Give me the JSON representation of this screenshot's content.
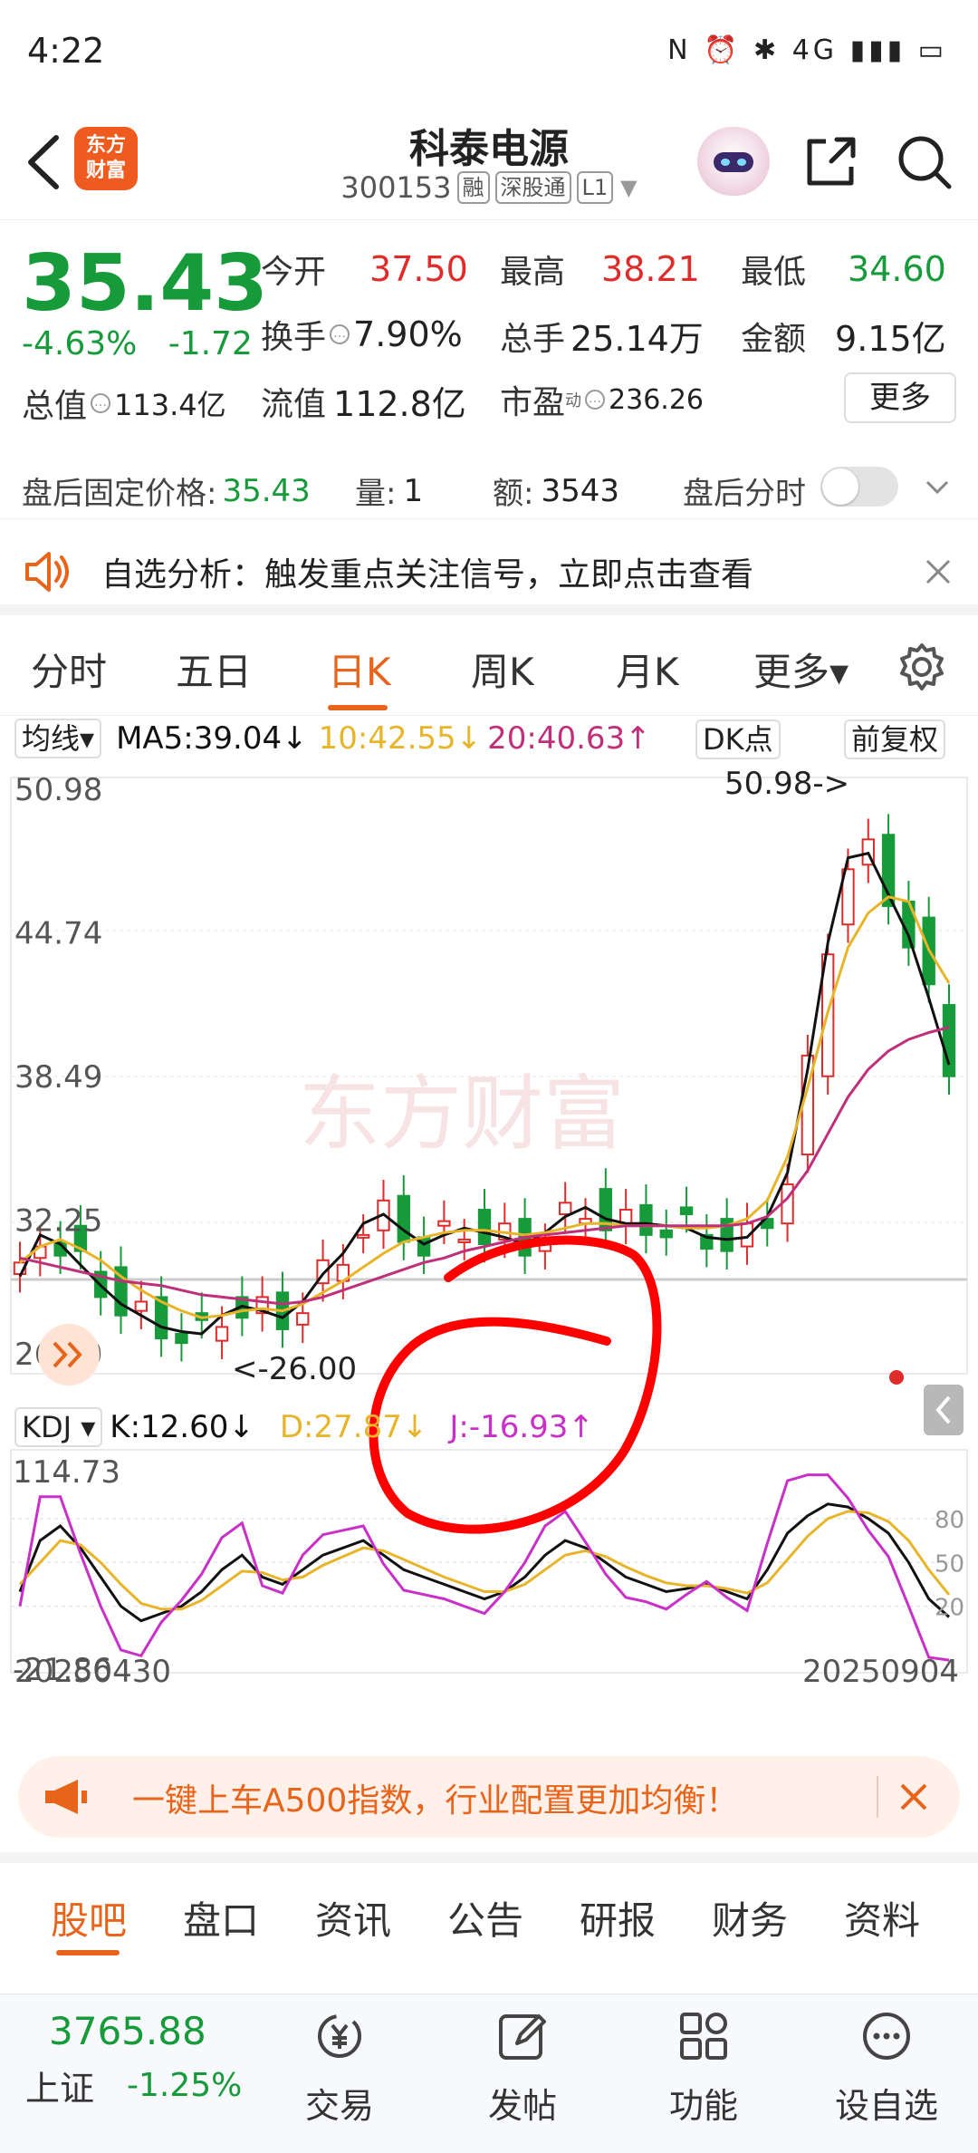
{
  "status_bar": {
    "time": "4:22",
    "icons_text": "N ⏰ ✱ 4G ▮▮▮ ▭"
  },
  "header": {
    "brand_line1": "东方",
    "brand_line2": "财富",
    "stock_name": "科泰电源",
    "stock_code": "300153",
    "tags": [
      "融",
      "深股通",
      "L1"
    ]
  },
  "quote": {
    "price": "35.43",
    "change_pct": "-4.63%",
    "change_abs": "-1.72",
    "open_label": "今开",
    "open_value": "37.50",
    "high_label": "最高",
    "high_value": "38.21",
    "low_label": "最低",
    "low_value": "34.60",
    "turnover_label": "换手",
    "turnover_value": "7.90%",
    "volume_label": "总手",
    "volume_value": "25.14万",
    "amount_label": "金额",
    "amount_value": "9.15亿",
    "total_cap_label": "总值",
    "total_cap_value": "113.4亿",
    "float_cap_label": "流值",
    "float_cap_value": "112.8亿",
    "pe_label": "市盈",
    "pe_sup": "动",
    "pe_value": "236.26",
    "more_button": "更多"
  },
  "after_hours": {
    "price_label": "盘后固定价格:",
    "price_value": "35.43",
    "qty_label": "量:",
    "qty_value": "1",
    "amt_label": "额:",
    "amt_value": "3543",
    "minute_label": "盘后分时"
  },
  "signal_banner": {
    "text": "自选分析：触发重点关注信号，立即点击查看"
  },
  "chart_tabs": [
    "分时",
    "五日",
    "日K",
    "周K",
    "月K",
    "更多▾"
  ],
  "active_chart_tab": "日K",
  "ma_bar": {
    "selector": "均线▾",
    "ma5": "MA5:39.04↓",
    "ma10": "10:42.55↓",
    "ma20": "20:40.63↑",
    "dk_button": "DK点",
    "adjust_button": "前复权"
  },
  "kdj_bar": {
    "selector": "KDJ ▾",
    "k": "K:12.60↓",
    "d": "D:27.87↓",
    "j": "J:-16.93↑"
  },
  "colors": {
    "up": "#e02b2b",
    "down": "#169a3a",
    "accent": "#e8641a",
    "ma5": "#111111",
    "ma10": "#e8b52a",
    "ma20": "#c0307a",
    "j_line": "#c830c8",
    "annotation": "#ff0000"
  },
  "chart_data": [
    {
      "type": "candlestick",
      "title": "",
      "y_ticks": [
        "50.98",
        "44.74",
        "38.49",
        "32.25",
        "26.00"
      ],
      "ylim": [
        26.0,
        50.98
      ],
      "max_label": "50.98->",
      "min_label": "<-26.00",
      "series": [
        {
          "name": "MA5",
          "values": [
            29.8,
            31.6,
            31.2,
            30.3,
            29.4,
            28.6,
            28.1,
            27.6,
            27.4,
            27.3,
            28.1,
            28.5,
            28.3,
            28.0,
            28.7,
            29.9,
            30.8,
            32.1,
            32.5,
            31.8,
            31.2,
            31.6,
            31.9,
            31.7,
            31.5,
            31.2,
            31.7,
            32.4,
            32.8,
            32.3,
            32.1,
            32.1,
            32.0,
            31.9,
            31.5,
            31.4,
            31.5,
            32.4,
            34.3,
            38.8,
            44.3,
            48.0,
            48.2,
            46.4,
            44.6,
            41.9,
            39.0
          ]
        },
        {
          "name": "MA10",
          "values": [
            30.4,
            31.1,
            31.4,
            31.0,
            30.5,
            29.8,
            29.2,
            28.7,
            28.3,
            28.0,
            28.1,
            28.3,
            28.4,
            28.3,
            28.6,
            29.1,
            29.6,
            30.2,
            30.8,
            31.3,
            31.5,
            31.7,
            31.8,
            31.8,
            31.7,
            31.6,
            31.7,
            31.9,
            32.1,
            32.1,
            32.0,
            32.0,
            32.0,
            31.9,
            31.9,
            32.0,
            32.3,
            33.1,
            35.0,
            38.0,
            41.3,
            44.1,
            45.6,
            46.3,
            46.1,
            44.0,
            42.55
          ]
        },
        {
          "name": "MA20",
          "values": [
            30.6,
            30.4,
            30.2,
            30.0,
            29.8,
            29.6,
            29.5,
            29.4,
            29.2,
            29.0,
            28.9,
            28.8,
            28.7,
            28.6,
            28.7,
            28.9,
            29.2,
            29.5,
            29.8,
            30.1,
            30.4,
            30.6,
            30.9,
            31.1,
            31.3,
            31.5,
            31.6,
            31.7,
            31.8,
            31.9,
            32.0,
            32.0,
            32.0,
            32.0,
            32.0,
            32.0,
            32.1,
            32.4,
            33.2,
            34.4,
            36.0,
            37.6,
            38.8,
            39.6,
            40.1,
            40.4,
            40.63
          ]
        }
      ]
    },
    {
      "type": "line",
      "title": "KDJ",
      "y_ticks": [
        "114.73",
        "-21.86"
      ],
      "right_ticks": [
        "80",
        "50",
        "20"
      ],
      "ylim": [
        -21.86,
        114.73
      ],
      "x_labels": [
        "20250430",
        "20250904"
      ],
      "series": [
        {
          "name": "K",
          "values": [
            30,
            65,
            75,
            60,
            40,
            20,
            10,
            15,
            20,
            30,
            45,
            55,
            40,
            35,
            45,
            55,
            60,
            65,
            55,
            45,
            40,
            35,
            30,
            25,
            30,
            40,
            55,
            65,
            60,
            50,
            40,
            35,
            30,
            32,
            35,
            30,
            25,
            45,
            70,
            82,
            90,
            88,
            80,
            70,
            50,
            25,
            12.6
          ]
        },
        {
          "name": "D",
          "values": [
            35,
            50,
            65,
            62,
            50,
            35,
            22,
            18,
            18,
            24,
            34,
            44,
            43,
            38,
            40,
            48,
            54,
            60,
            58,
            52,
            46,
            40,
            35,
            30,
            30,
            35,
            45,
            55,
            58,
            54,
            47,
            41,
            36,
            34,
            34,
            32,
            29,
            36,
            52,
            68,
            80,
            85,
            84,
            78,
            65,
            45,
            27.87
          ]
        },
        {
          "name": "J",
          "values": [
            20,
            95,
            95,
            56,
            20,
            -10,
            -14,
            9,
            24,
            42,
            67,
            77,
            34,
            29,
            55,
            69,
            72,
            75,
            49,
            31,
            28,
            25,
            20,
            15,
            30,
            50,
            75,
            85,
            64,
            42,
            26,
            23,
            18,
            28,
            37,
            26,
            17,
            63,
            106,
            110,
            110,
            94,
            72,
            54,
            20,
            -15,
            -16.93
          ]
        }
      ]
    }
  ],
  "promo": {
    "text": "一键上车A500指数，行业配置更加均衡！"
  },
  "bottom_tabs": [
    "股吧",
    "盘口",
    "资讯",
    "公告",
    "研报",
    "财务",
    "资料"
  ],
  "active_bottom_tab": "股吧",
  "bottom_nav": {
    "index_value": "3765.88",
    "index_name": "上证",
    "index_change": "-1.25%",
    "items": [
      "交易",
      "发帖",
      "功能",
      "设自选"
    ]
  }
}
